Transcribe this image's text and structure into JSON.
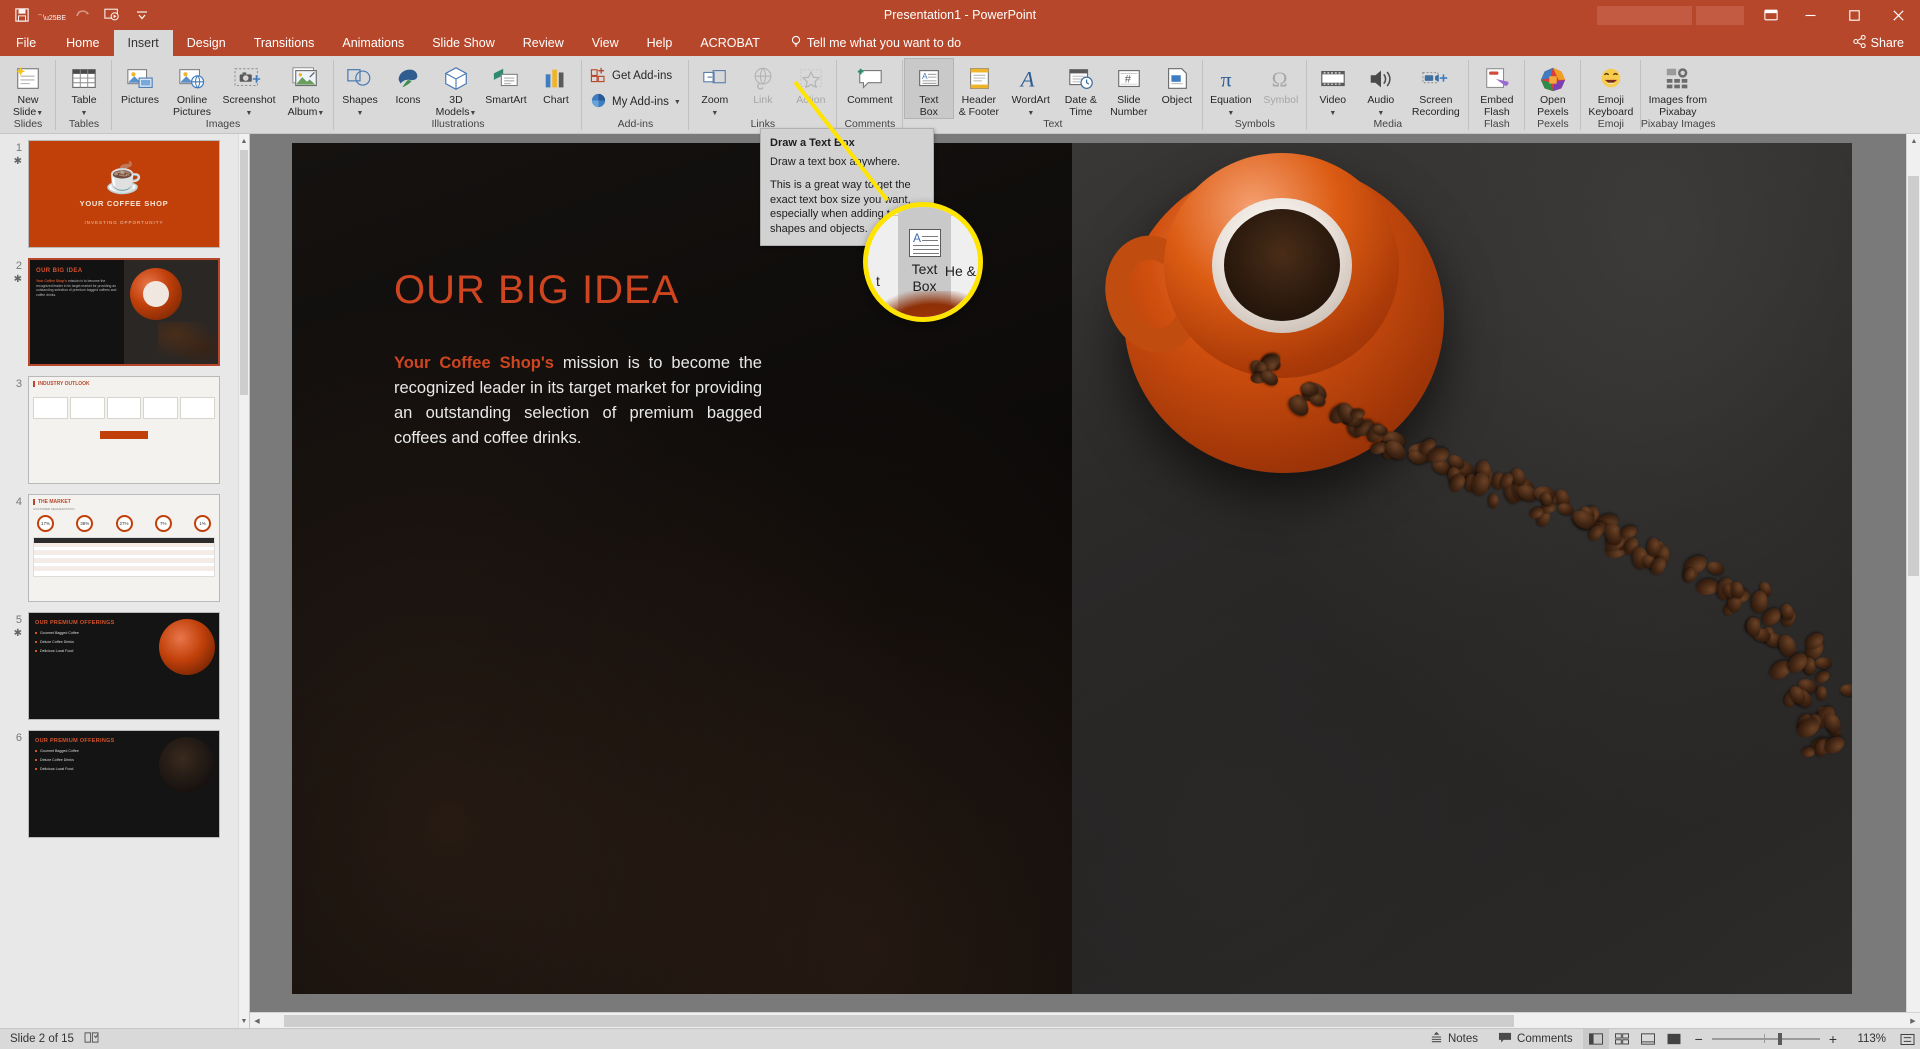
{
  "titlebar": {
    "title": "Presentation1  -  PowerPoint",
    "qat": [
      {
        "name": "save",
        "glyph": "💾"
      },
      {
        "name": "undo",
        "glyph": "↶"
      },
      {
        "name": "redo",
        "glyph": "↻"
      },
      {
        "name": "start-slideshow",
        "glyph": "▶"
      },
      {
        "name": "customize-qat",
        "glyph": "▾"
      }
    ],
    "ribbon_display_options": "❐",
    "minimize": "—",
    "restore": "❐",
    "close": "✕"
  },
  "tabs": [
    {
      "label": "File",
      "active": false
    },
    {
      "label": "Home",
      "active": false
    },
    {
      "label": "Insert",
      "active": true
    },
    {
      "label": "Design",
      "active": false
    },
    {
      "label": "Transitions",
      "active": false
    },
    {
      "label": "Animations",
      "active": false
    },
    {
      "label": "Slide Show",
      "active": false
    },
    {
      "label": "Review",
      "active": false
    },
    {
      "label": "View",
      "active": false
    },
    {
      "label": "Help",
      "active": false
    },
    {
      "label": "ACROBAT",
      "active": false
    }
  ],
  "tell_me": "Tell me what you want to do",
  "share": "Share",
  "ribbon": {
    "groups": [
      {
        "label": "Slides",
        "buttons": [
          {
            "label": "New\nSlide",
            "icon": "new-slide-icon",
            "dropdown": true,
            "width": "w52"
          }
        ]
      },
      {
        "label": "Tables",
        "buttons": [
          {
            "label": "Table",
            "icon": "table-icon",
            "dropdown": true,
            "width": "w52"
          }
        ]
      },
      {
        "label": "Images",
        "buttons": [
          {
            "label": "Pictures",
            "icon": "pictures-icon",
            "dropdown": false,
            "width": "w52"
          },
          {
            "label": "Online\nPictures",
            "icon": "online-pictures-icon",
            "dropdown": false,
            "width": "w52"
          },
          {
            "label": "Screenshot",
            "icon": "screenshot-icon",
            "dropdown": true,
            "width": "w62"
          },
          {
            "label": "Photo\nAlbum",
            "icon": "photo-album-icon",
            "dropdown": true,
            "width": "w52"
          }
        ]
      },
      {
        "label": "Illustrations",
        "buttons": [
          {
            "label": "Shapes",
            "icon": "shapes-icon",
            "dropdown": true,
            "width": "w48"
          },
          {
            "label": "Icons",
            "icon": "icons-icon",
            "dropdown": false,
            "width": "w40"
          },
          {
            "label": "3D\nModels",
            "icon": "3d-models-icon",
            "dropdown": true,
            "width": "w48"
          },
          {
            "label": "SmartArt",
            "icon": "smartart-icon",
            "dropdown": false,
            "width": "w52"
          },
          {
            "label": "Chart",
            "icon": "chart-icon",
            "dropdown": false,
            "width": "w40"
          }
        ]
      },
      {
        "label": "Add-ins",
        "small_buttons": [
          {
            "label": "Get Add-ins",
            "icon": "get-addins-icon"
          },
          {
            "label": "My Add-ins",
            "icon": "my-addins-icon",
            "dropdown": true
          }
        ]
      },
      {
        "label": "Links",
        "buttons": [
          {
            "label": "Zoom",
            "icon": "zoom-icon",
            "dropdown": true,
            "width": "w48"
          },
          {
            "label": "Link",
            "icon": "link-icon",
            "disabled": true,
            "width": "w40"
          },
          {
            "label": "Action",
            "icon": "action-icon",
            "disabled": true,
            "width": "w48"
          }
        ]
      },
      {
        "label": "Comments",
        "buttons": [
          {
            "label": "Comment",
            "icon": "comment-icon",
            "dropdown": false,
            "width": "w62"
          }
        ]
      },
      {
        "label": "Text",
        "buttons": [
          {
            "label": "Text\nBox",
            "icon": "text-box-icon",
            "highlighted": true,
            "width": "w48"
          },
          {
            "label": "Header\n& Footer",
            "icon": "header-footer-icon",
            "width": "w52"
          },
          {
            "label": "WordArt",
            "icon": "wordart-icon",
            "dropdown": true,
            "width": "w52"
          },
          {
            "label": "Date &\nTime",
            "icon": "date-time-icon",
            "width": "w48"
          },
          {
            "label": "Slide\nNumber",
            "icon": "slide-number-icon",
            "width": "w48"
          },
          {
            "label": "Object",
            "icon": "object-icon",
            "width": "w48"
          }
        ]
      },
      {
        "label": "Symbols",
        "buttons": [
          {
            "label": "Equation",
            "icon": "equation-icon",
            "dropdown": true,
            "width": "w52"
          },
          {
            "label": "Symbol",
            "icon": "symbol-icon",
            "disabled": true,
            "width": "w48"
          }
        ]
      },
      {
        "label": "Media",
        "buttons": [
          {
            "label": "Video",
            "icon": "video-icon",
            "dropdown": true,
            "width": "w48"
          },
          {
            "label": "Audio",
            "icon": "audio-icon",
            "dropdown": true,
            "width": "w48"
          },
          {
            "label": "Screen\nRecording",
            "icon": "screen-recording-icon",
            "width": "w58"
          }
        ]
      },
      {
        "label": "Flash",
        "buttons": [
          {
            "label": "Embed\nFlash",
            "icon": "embed-flash-icon",
            "width": "w52"
          }
        ]
      },
      {
        "label": "Pexels",
        "buttons": [
          {
            "label": "Open\nPexels",
            "icon": "open-pexels-icon",
            "width": "w52"
          }
        ]
      },
      {
        "label": "Emoji",
        "buttons": [
          {
            "label": "Emoji\nKeyboard",
            "icon": "emoji-keyboard-icon",
            "width": "w56"
          }
        ]
      },
      {
        "label": "Pixabay Images",
        "buttons": [
          {
            "label": "Images from\nPixabay",
            "icon": "images-from-pixabay-icon",
            "width": "w70"
          }
        ]
      }
    ]
  },
  "tooltip": {
    "title": "Draw a Text Box",
    "line1": "Draw a text box anywhere.",
    "line2": "This is a great way to get the exact text box size you want, especially when adding text to shapes and objects."
  },
  "magnifier": {
    "label": "Text Box",
    "left_fragment": "t",
    "right_fragment": "He &"
  },
  "slide_panel": {
    "slides": [
      {
        "number": "1",
        "star": "✱",
        "selected": false,
        "title": "YOUR COFFEE SHOP",
        "subtitle": "INVESTING OPPORTUNITY"
      },
      {
        "number": "2",
        "star": "✱",
        "selected": true,
        "title": "OUR BIG IDEA",
        "body_accent": "Your Coffee Shop's",
        "body": " mission is to become the recognized leader in its target market for providing an outstanding selection of premium bagged coffees and coffee drinks."
      },
      {
        "number": "3",
        "star": "",
        "selected": false,
        "title": "INDUSTRY OUTLOOK",
        "pill": ""
      },
      {
        "number": "4",
        "star": "",
        "selected": false,
        "title": "THE MARKET",
        "subtitle": "CUSTOMER SEGMENTATION",
        "rings": [
          "17%",
          "38%",
          "27%",
          "7%",
          "1%"
        ]
      },
      {
        "number": "5",
        "star": "✱",
        "selected": false,
        "title": "OUR PREMIUM OFFERINGS",
        "items": [
          "Gourmet Bagged Coffee",
          "Deluxe Coffee Drinks",
          "Delicious Local Food"
        ]
      },
      {
        "number": "6",
        "star": "",
        "selected": false,
        "title": "OUR PREMIUM OFFERINGS",
        "items": [
          "Gourmet Bagged Coffee",
          "Deluxe Coffee Drinks",
          "Delicious Local Food"
        ]
      }
    ]
  },
  "slide": {
    "title": "OUR BIG IDEA",
    "body_accent": "Your Coffee Shop's",
    "body_rest": " mission is to become the recognized leader in its target market for providing an outstanding selection of premium bagged coffees and coffee drinks."
  },
  "statusbar": {
    "slide_indicator": "Slide 2 of 15",
    "accessibility_icon": "📖",
    "notes": "Notes",
    "comments": "Comments",
    "zoom_percent": "113%",
    "zoom_out": "−",
    "zoom_in": "+",
    "views": [
      {
        "name": "normal-view",
        "glyph": "▣",
        "active": true
      },
      {
        "name": "slide-sorter-view",
        "glyph": "⌸",
        "active": false
      },
      {
        "name": "reading-view",
        "glyph": "▭",
        "active": false
      },
      {
        "name": "slide-show-view",
        "glyph": "❐",
        "active": false
      }
    ],
    "fit_slide": "⤢"
  },
  "colors": {
    "brand": "#b7472a",
    "accent": "#cf4520",
    "highlight": "#ffe400",
    "ribbon_bg": "#d9d9d9"
  }
}
